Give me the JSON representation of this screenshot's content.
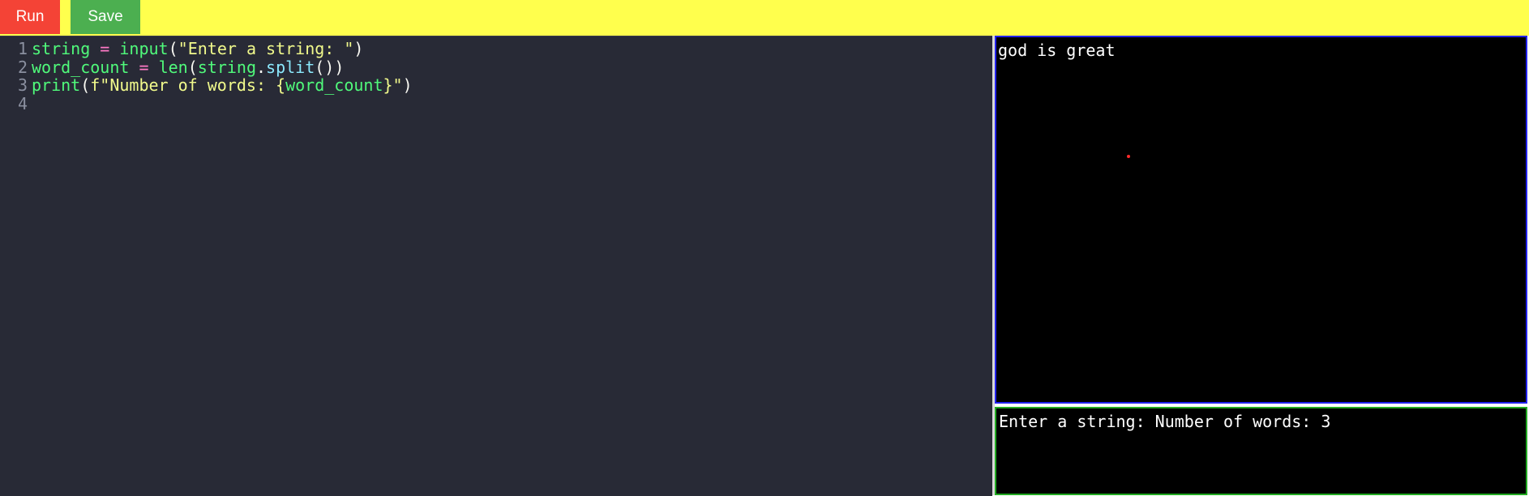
{
  "toolbar": {
    "run_label": "Run",
    "save_label": "Save",
    "background_color": "#ffff4d",
    "run_color": "#f44336",
    "save_color": "#4caf50"
  },
  "editor": {
    "theme_background": "#282a36",
    "lines": [
      {
        "number": "1",
        "tokens": [
          {
            "text": "string",
            "kind": "var"
          },
          {
            "text": " ",
            "kind": "punc"
          },
          {
            "text": "=",
            "kind": "op"
          },
          {
            "text": " ",
            "kind": "punc"
          },
          {
            "text": "input",
            "kind": "fn"
          },
          {
            "text": "(",
            "kind": "punc"
          },
          {
            "text": "\"Enter a string: \"",
            "kind": "str"
          },
          {
            "text": ")",
            "kind": "punc"
          }
        ]
      },
      {
        "number": "2",
        "tokens": [
          {
            "text": "word_count",
            "kind": "var"
          },
          {
            "text": " ",
            "kind": "punc"
          },
          {
            "text": "=",
            "kind": "op"
          },
          {
            "text": " ",
            "kind": "punc"
          },
          {
            "text": "len",
            "kind": "fn"
          },
          {
            "text": "(",
            "kind": "punc"
          },
          {
            "text": "string",
            "kind": "var"
          },
          {
            "text": ".",
            "kind": "punc"
          },
          {
            "text": "split",
            "kind": "method"
          },
          {
            "text": "())",
            "kind": "punc"
          }
        ]
      },
      {
        "number": "3",
        "tokens": [
          {
            "text": "print",
            "kind": "fn"
          },
          {
            "text": "(",
            "kind": "punc"
          },
          {
            "text": "f\"Number of words: {",
            "kind": "str"
          },
          {
            "text": "word_count",
            "kind": "var"
          },
          {
            "text": "}\"",
            "kind": "str"
          },
          {
            "text": ")",
            "kind": "punc"
          }
        ]
      },
      {
        "number": "4",
        "tokens": []
      }
    ]
  },
  "canvas": {
    "text": "god is great",
    "border_color": "#2222ee",
    "dot_color": "#ff2a2a"
  },
  "console": {
    "text": "Enter a string: Number of words: 3",
    "border_color": "#22aa22"
  }
}
